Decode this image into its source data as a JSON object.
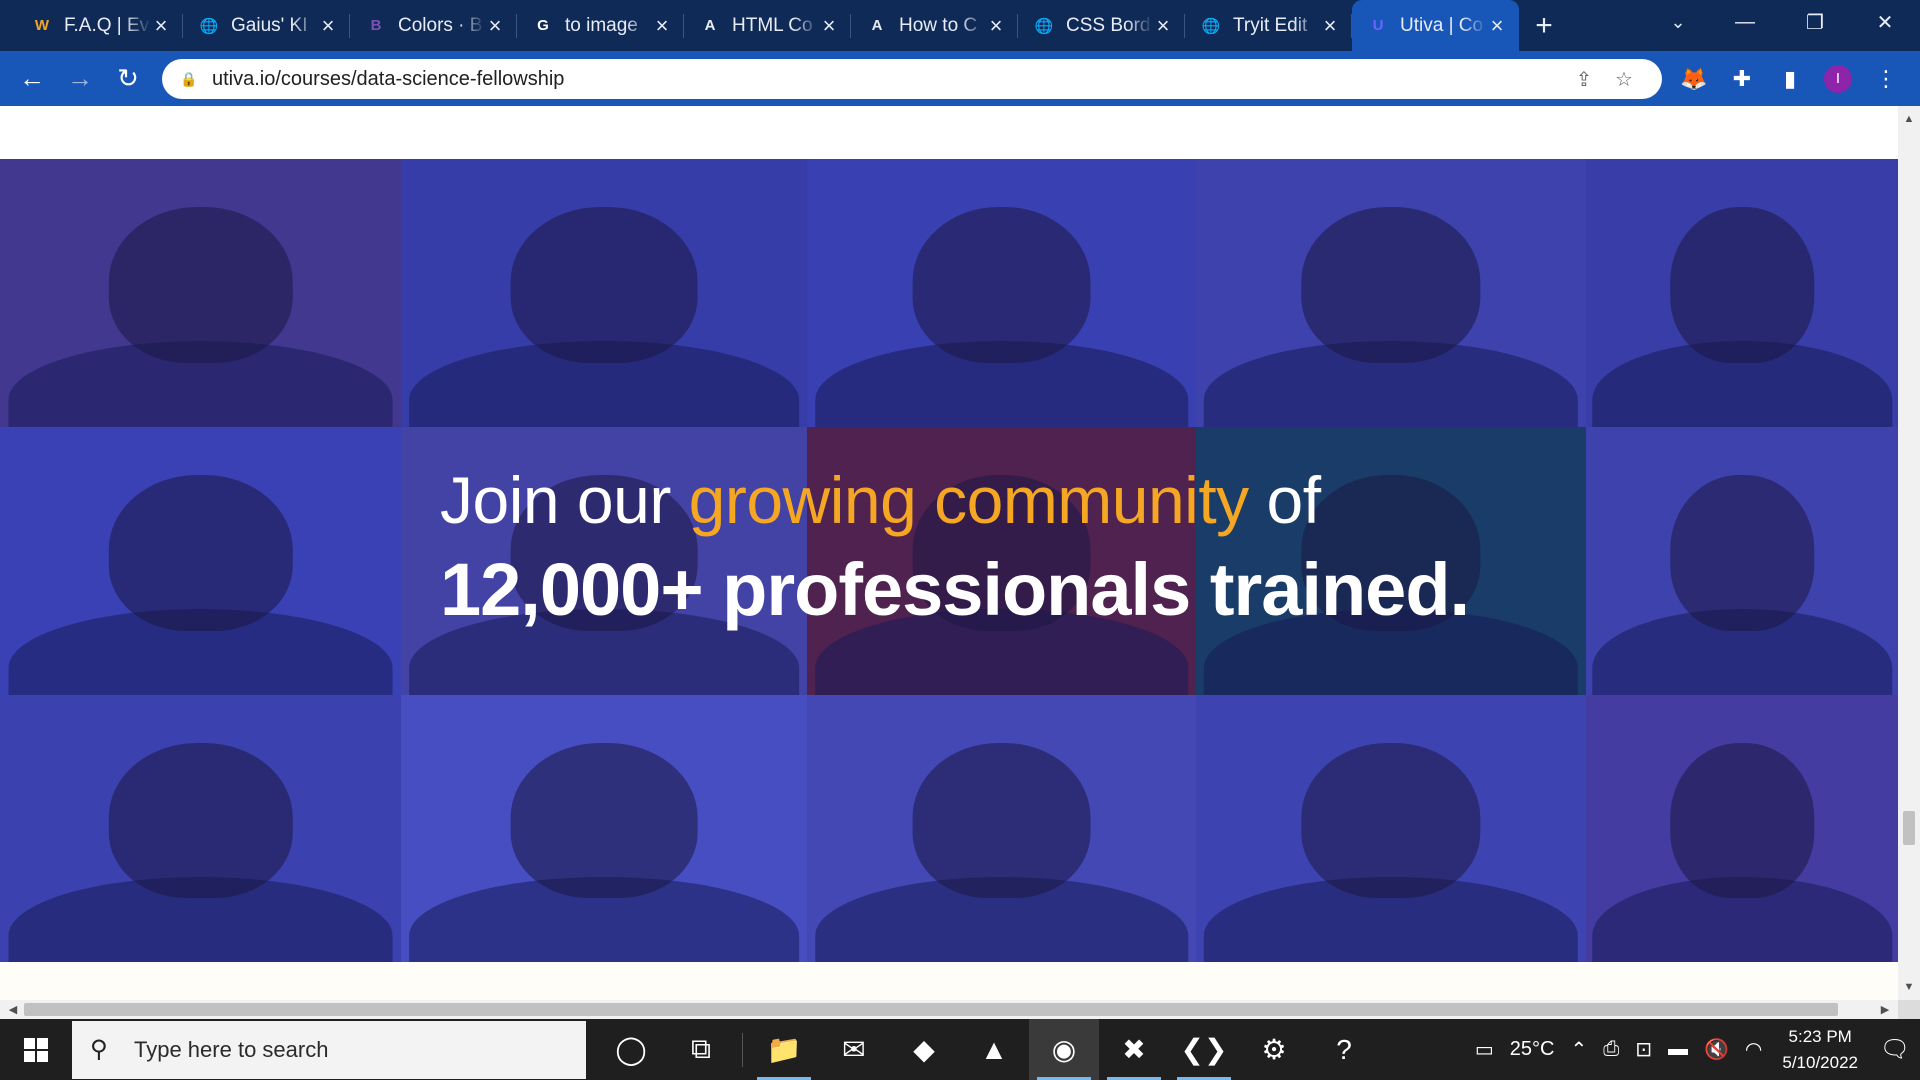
{
  "browser": {
    "tabs": [
      {
        "title": "F.A.Q | Ev",
        "icon": "w-logo-icon",
        "glyph": "W",
        "color": "#f5a623",
        "active": false
      },
      {
        "title": "Gaius' KI",
        "icon": "globe-icon",
        "glyph": "🌐",
        "color": "#e8ecf4",
        "active": false
      },
      {
        "title": "Colors · B",
        "icon": "bootstrap-icon",
        "glyph": "B",
        "color": "#7952b3",
        "active": false
      },
      {
        "title": "to image",
        "icon": "google-icon",
        "glyph": "G",
        "color": "#ffffff",
        "active": false
      },
      {
        "title": "HTML Co",
        "icon": "a-logo-icon",
        "glyph": "A",
        "color": "#e8ecf4",
        "active": false
      },
      {
        "title": "How to C",
        "icon": "a-logo-icon",
        "glyph": "A",
        "color": "#e8ecf4",
        "active": false
      },
      {
        "title": "CSS Bord",
        "icon": "globe-icon",
        "glyph": "🌐",
        "color": "#e8ecf4",
        "active": false
      },
      {
        "title": "Tryit Edit",
        "icon": "globe-icon",
        "glyph": "🌐",
        "color": "#e8ecf4",
        "active": false
      },
      {
        "title": "Utiva | Co",
        "icon": "utiva-logo-icon",
        "glyph": "U",
        "color": "#6c63ff",
        "active": true
      }
    ],
    "new_tab": "+",
    "url": "utiva.io/courses/data-science-fellowship",
    "profile_initial": "I",
    "accent": "#1857b8",
    "tabstrip_color": "#0f2a57"
  },
  "page": {
    "headline": {
      "line1_pre": "Join our ",
      "line1_accent": "growing community",
      "line1_post": " of",
      "line2": "12,000+ professionals trained."
    },
    "accent_color": "#f5a623",
    "photo_grid": {
      "rows": 3,
      "columns": 5,
      "tile_colors": [
        [
          "#4a3a8a",
          "#3a40a8",
          "#3e44b2",
          "#4246ae",
          "#3c40a6"
        ],
        [
          "#3d45b8",
          "#4a46a4",
          "#5a1f3c",
          "#173f5a",
          "#4446ae"
        ],
        [
          "#4045b0",
          "#4d55c6",
          "#4a4eb8",
          "#4349b2",
          "#4b3f9e"
        ]
      ]
    }
  },
  "taskbar": {
    "search_placeholder": "Type here to search",
    "temperature": "25°C",
    "time": "5:23 PM",
    "date": "5/10/2022",
    "apps": [
      {
        "name": "cortana-icon",
        "glyph": "◯",
        "running": false,
        "active": false
      },
      {
        "name": "task-view-icon",
        "glyph": "⧉",
        "running": false,
        "active": false
      },
      {
        "name": "file-explorer-icon",
        "glyph": "📁",
        "running": true,
        "active": false
      },
      {
        "name": "mail-icon",
        "glyph": "✉",
        "running": false,
        "active": false
      },
      {
        "name": "git-icon",
        "glyph": "◆",
        "running": false,
        "active": false
      },
      {
        "name": "vlc-icon",
        "glyph": "▲",
        "running": false,
        "active": false
      },
      {
        "name": "chrome-icon",
        "glyph": "◉",
        "running": true,
        "active": true
      },
      {
        "name": "xampp-icon",
        "glyph": "✖",
        "running": true,
        "active": false
      },
      {
        "name": "vscode-icon",
        "glyph": "❮❯",
        "running": true,
        "active": false
      },
      {
        "name": "settings-icon",
        "glyph": "⚙",
        "running": false,
        "active": false
      },
      {
        "name": "help-icon",
        "glyph": "?",
        "running": false,
        "active": false
      }
    ]
  }
}
